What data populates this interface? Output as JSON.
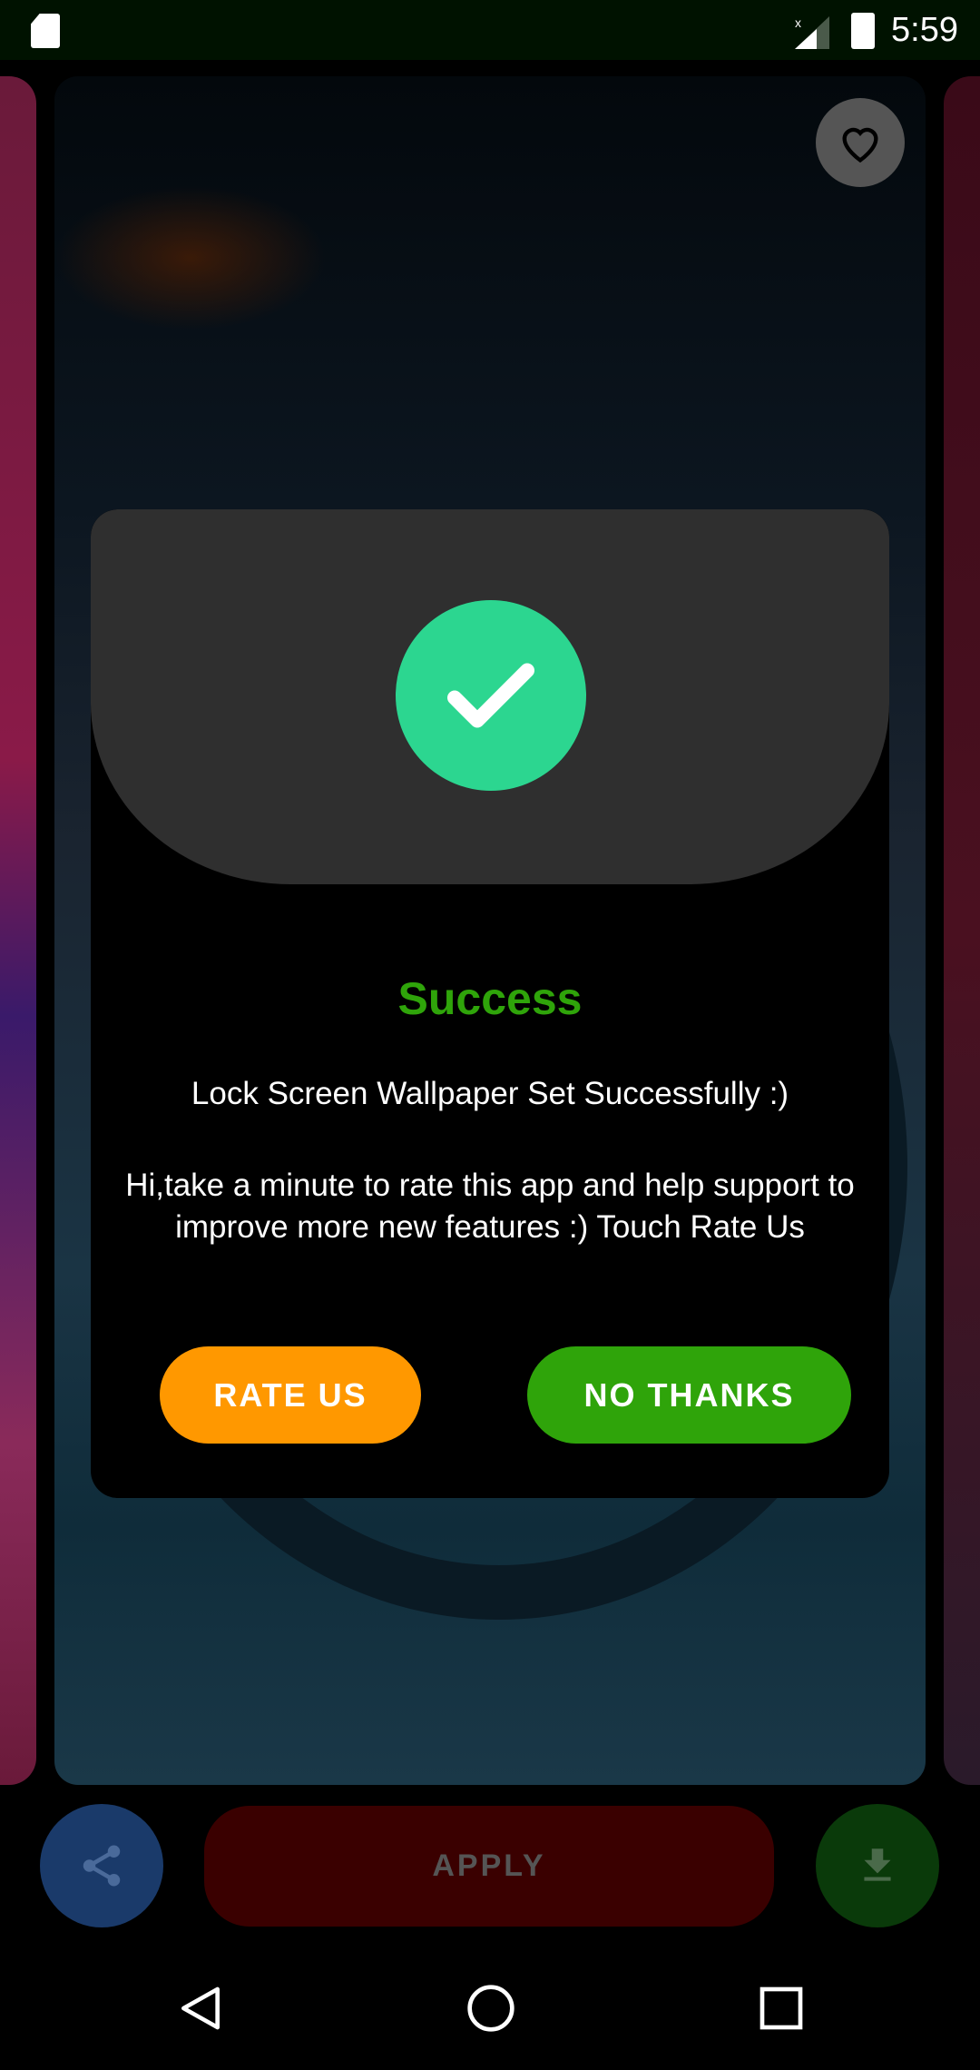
{
  "status_bar": {
    "time": "5:59",
    "icons": [
      "sd-card-icon",
      "signal-no-data-icon",
      "battery-charging-icon"
    ]
  },
  "dialog": {
    "title": "Success",
    "message": "Lock Screen Wallpaper Set Successfully :)",
    "prompt": "Hi,take a minute to rate this app and help support to improve more new features :) Touch Rate Us",
    "rate_label": "RATE US",
    "no_thanks_label": "NO THANKS",
    "colors": {
      "success": "#2fa40a",
      "check": "#2cd690",
      "rate": "#ff9800",
      "no_thanks": "#2fa40a"
    }
  },
  "actions": {
    "apply_label": "APPLY",
    "share_icon": "share-icon",
    "download_icon": "download-icon",
    "favorite_icon": "heart-icon"
  },
  "nav": {
    "back": "back-icon",
    "home": "home-icon",
    "recents": "recents-icon"
  }
}
